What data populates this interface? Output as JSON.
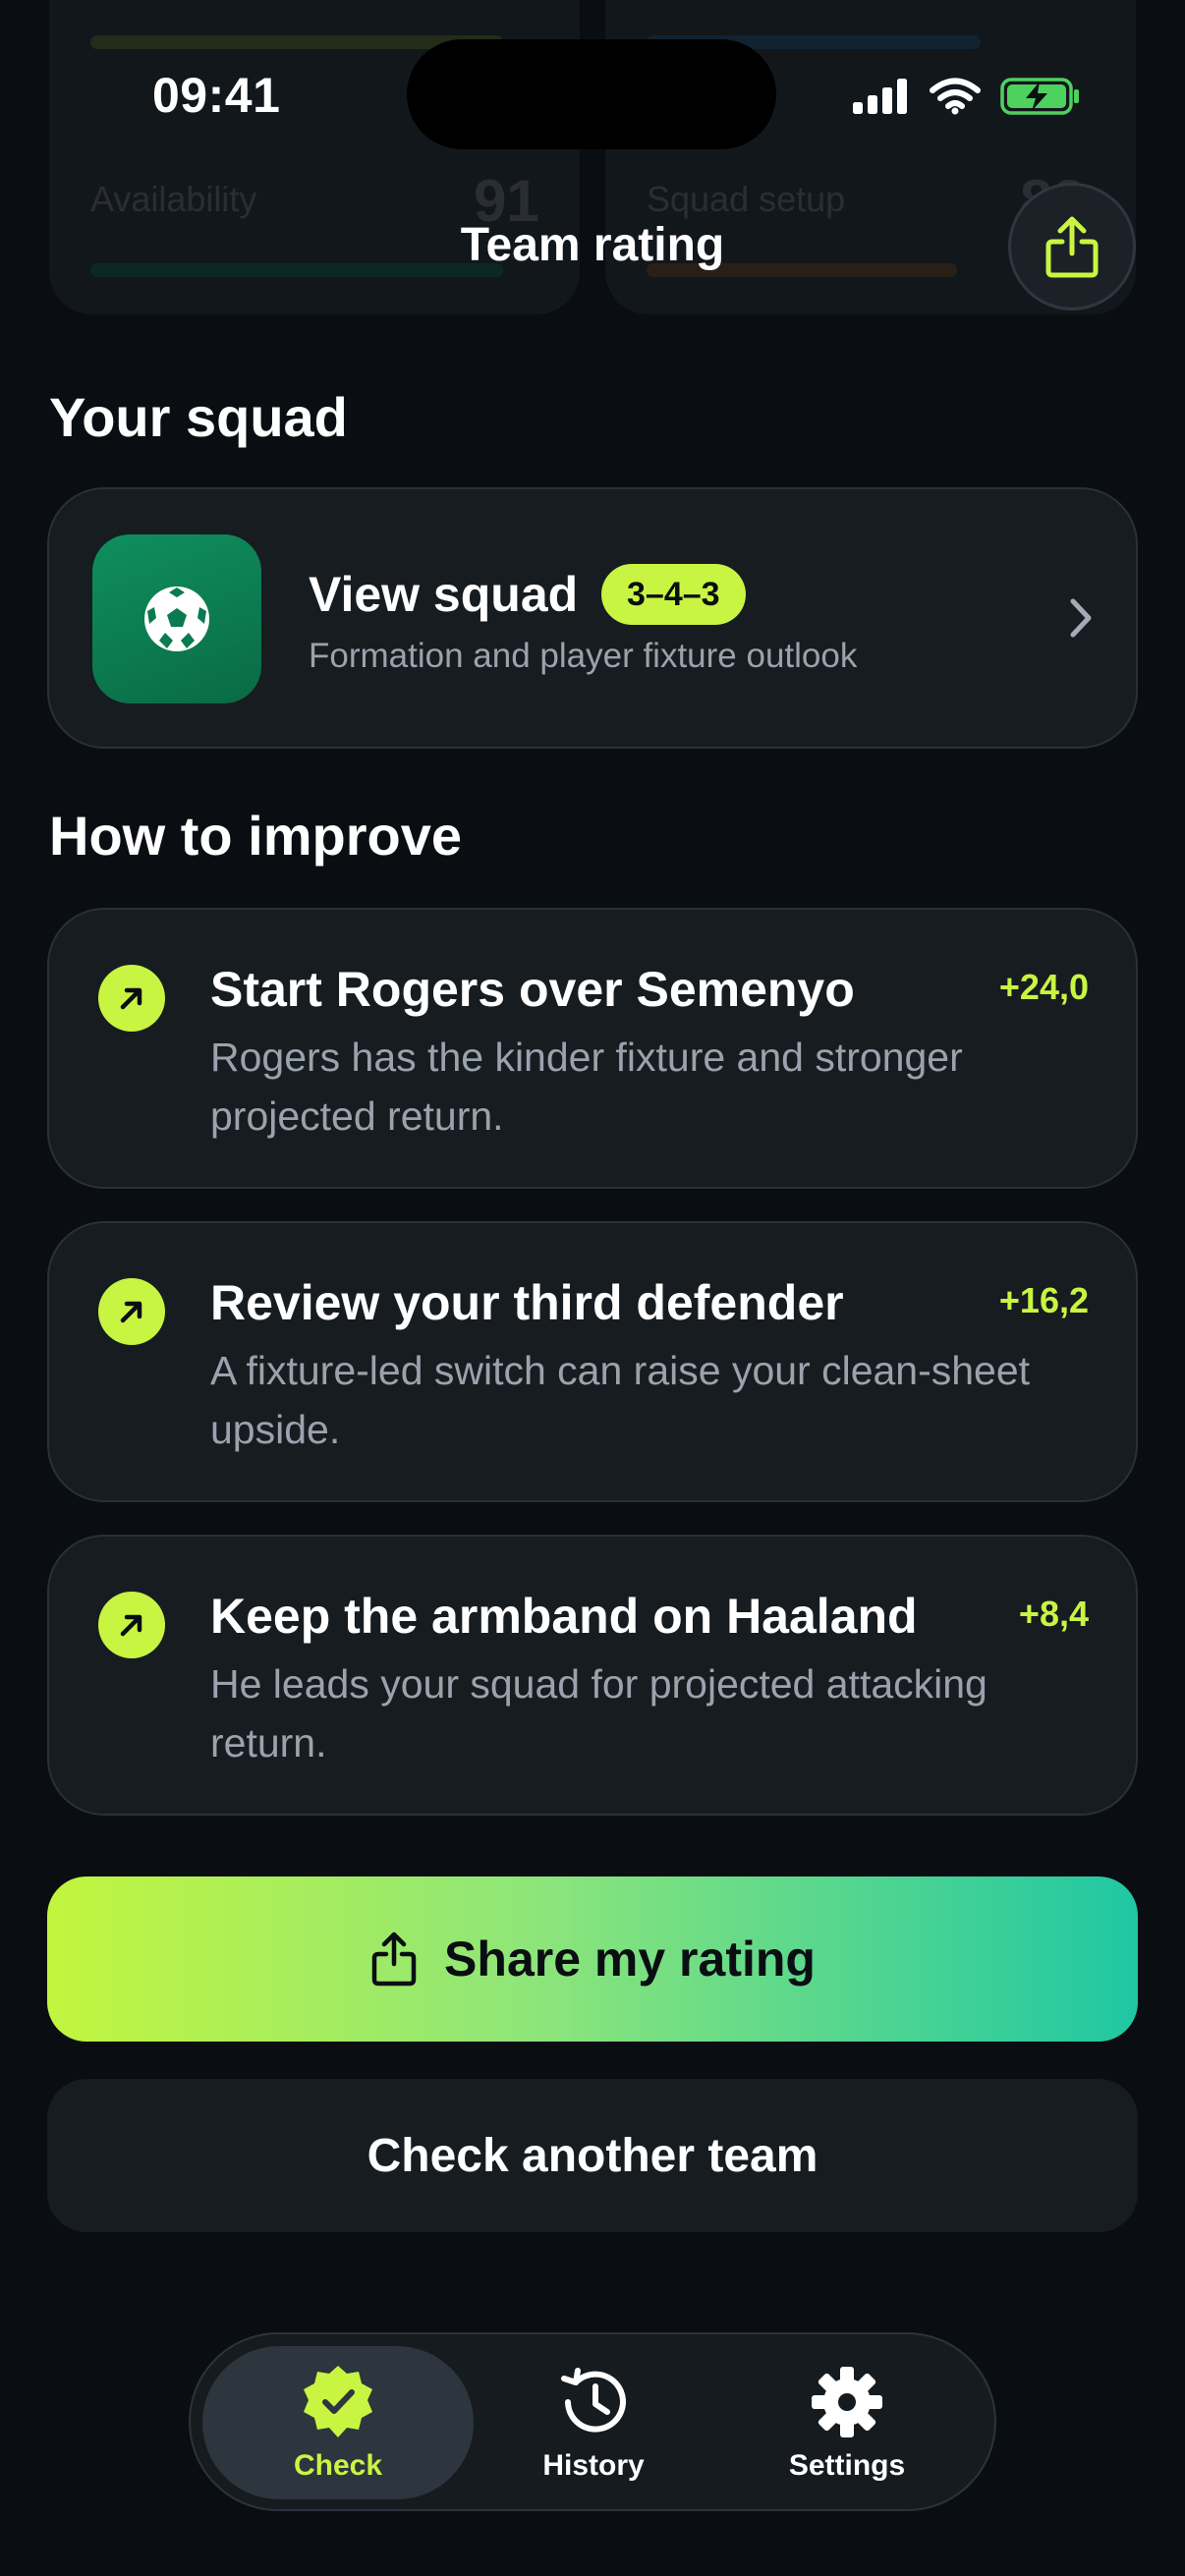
{
  "status_bar": {
    "time": "09:41"
  },
  "header": {
    "title": "Team rating"
  },
  "ghost": {
    "left_label": "Availability",
    "left_value": "91",
    "right_label": "Squad setup",
    "right_value": "82"
  },
  "squad_section": {
    "title": "Your squad",
    "card_title": "View squad",
    "formation": "3–4–3",
    "subtitle": "Formation and player fixture outlook"
  },
  "improve_section": {
    "title": "How to improve",
    "tips": [
      {
        "title": "Start Rogers over Semenyo",
        "score": "+24,0",
        "body": "Rogers has the kinder fixture and stronger projected return."
      },
      {
        "title": "Review your third defender",
        "score": "+16,2",
        "body": "A fixture-led switch can raise your clean-sheet upside."
      },
      {
        "title": "Keep the armband on Haaland",
        "score": "+8,4",
        "body": "He leads your squad for projected attacking return."
      }
    ]
  },
  "actions": {
    "share_label": "Share my rating",
    "check_label": "Check another team"
  },
  "tabs": [
    {
      "label": "Check",
      "icon": "check-badge-icon"
    },
    {
      "label": "History",
      "icon": "history-icon"
    },
    {
      "label": "Settings",
      "icon": "gear-icon"
    }
  ],
  "colors": {
    "accent": "#c8f542",
    "background": "#0a0e12",
    "card": "#171c21",
    "gradient_start": "#c2f53e",
    "gradient_end": "#1fc7a3"
  }
}
